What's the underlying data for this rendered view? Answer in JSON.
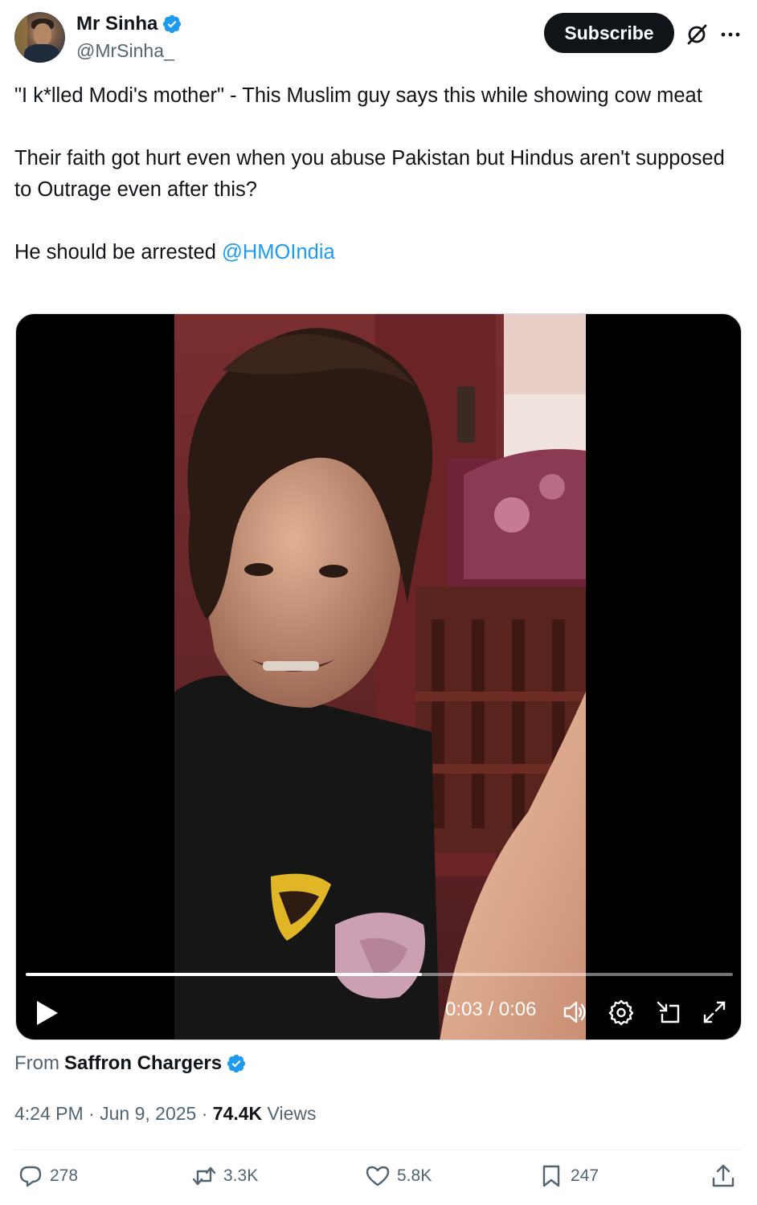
{
  "author": {
    "display_name": "Mr Sinha",
    "handle": "@MrSinha_",
    "verified_icon": "verified-badge-icon",
    "avatar": "profile-avatar"
  },
  "header": {
    "subscribe_label": "Subscribe",
    "grok_icon": "grok-icon",
    "more_icon": "more-options-icon"
  },
  "tweet": {
    "line1": "\"I k*lled Modi's mother\" - This Muslim guy says this while showing cow meat",
    "line2": "Their faith got hurt even when you abuse Pakistan but Hindus aren't supposed to Outrage even after this?",
    "line3_prefix": "He should be arrested ",
    "mention": "@HMOIndia"
  },
  "video": {
    "current_time": "0:03",
    "separator": " / ",
    "duration": "0:06",
    "progress_fraction": 0.56,
    "play_icon": "play-icon",
    "volume_icon": "volume-icon",
    "settings_icon": "settings-gear-icon",
    "pip_icon": "picture-in-picture-icon",
    "fullscreen_icon": "fullscreen-icon"
  },
  "source": {
    "prefix": "From",
    "name": "Saffron Chargers"
  },
  "meta": {
    "time": "4:24 PM",
    "dot": " · ",
    "date": "Jun 9, 2025",
    "views_count": "74.4K",
    "views_label": "Views"
  },
  "actions": {
    "replies": "278",
    "reposts": "3.3K",
    "likes": "5.8K",
    "bookmarks": "247"
  },
  "colors": {
    "text": "#0f1419",
    "secondary": "#536471",
    "accent": "#1d9bf0",
    "button_bg": "#0f1419"
  }
}
